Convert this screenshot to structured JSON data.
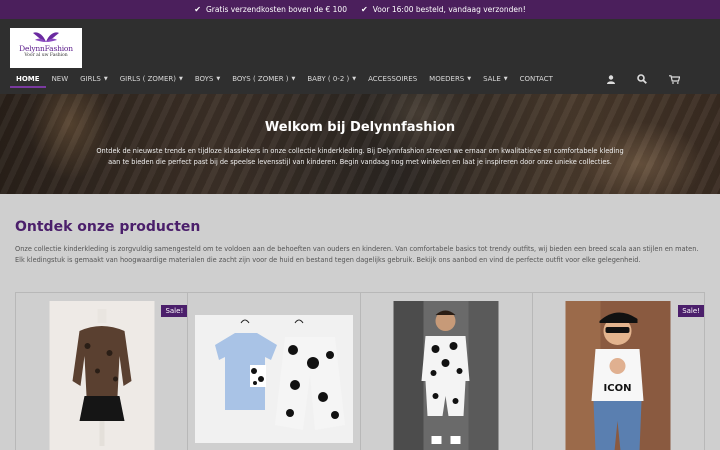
{
  "topbar": {
    "usps": [
      "Gratis verzendkosten boven de € 100",
      "Voor 16:00 besteld, vandaag verzonden!"
    ]
  },
  "logo": {
    "name": "DelynnFashion",
    "tagline": "Voor al uw Fashion"
  },
  "nav": {
    "items": [
      {
        "label": "HOME",
        "dropdown": false,
        "active": true
      },
      {
        "label": "NEW",
        "dropdown": false
      },
      {
        "label": "GIRLS",
        "dropdown": true
      },
      {
        "label": "GIRLS ( ZOMER)",
        "dropdown": true
      },
      {
        "label": "BOYS",
        "dropdown": true
      },
      {
        "label": "BOYS ( ZOMER )",
        "dropdown": true
      },
      {
        "label": "BABY ( 0-2 )",
        "dropdown": true
      },
      {
        "label": "ACCESSOIRES",
        "dropdown": false
      },
      {
        "label": "MOEDERS",
        "dropdown": true
      },
      {
        "label": "SALE",
        "dropdown": true
      },
      {
        "label": "CONTACT",
        "dropdown": false
      }
    ],
    "icons": [
      "user-icon",
      "search-icon",
      "cart-icon"
    ]
  },
  "hero": {
    "title": "Welkom bij Delynnfashion",
    "text": "Ontdek de nieuwste trends en tijdloze klassiekers in onze collectie kinderkleding. Bij Delynnfashion streven we ernaar om kwalitatieve en comfortabele kleding aan te bieden die perfect past bij de speelse levensstijl van kinderen. Begin vandaag nog met winkelen en laat je inspireren door onze unieke collecties."
  },
  "products_section": {
    "title": "Ontdek onze producten",
    "text": "Onze collectie kinderkleding is zorgvuldig samengesteld om te voldoen aan de behoeften van ouders en kinderen. Van comfortabele basics tot trendy outfits, wij bieden een breed scala aan stijlen en maten. Elk kledingstuk is gemaakt van hoogwaardige materialen die zacht zijn voor de huid en bestand tegen dagelijks gebruik. Bekijk ons aanbod en vind de perfecte outfit voor elke gelegenheid."
  },
  "products": [
    {
      "badge": "Sale!"
    },
    {
      "badge": ""
    },
    {
      "badge": ""
    },
    {
      "badge": "Sale!"
    }
  ],
  "colors": {
    "brand_purple": "#4b1f6b",
    "header_bg": "#2f2f2f",
    "topbar_bg": "#4b1f5c"
  }
}
